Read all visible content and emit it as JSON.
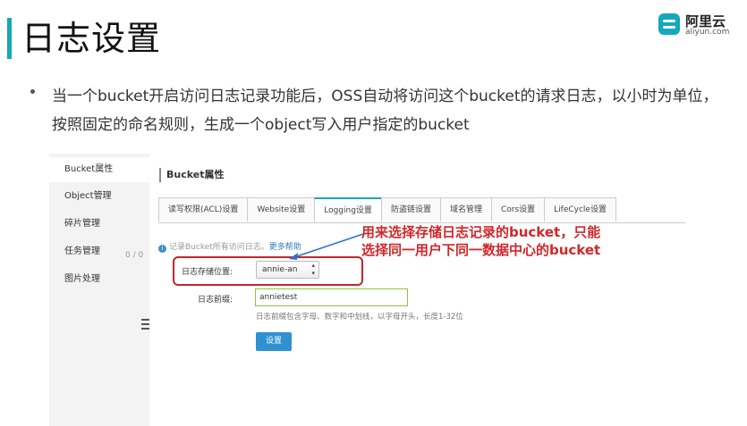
{
  "slide": {
    "title": "日志设置",
    "bullet": "当一个bucket开启访问日志记录功能后，OSS自动将访问这个bucket的请求日志，以小时为单位，按照固定的命名规则，生成一个object写入用户指定的bucket"
  },
  "logo": {
    "cn": "阿里云",
    "en": "aliyun.com"
  },
  "sidebar": {
    "items": [
      {
        "label": "Bucket属性"
      },
      {
        "label": "Object管理"
      },
      {
        "label": "碎片管理"
      },
      {
        "label": "任务管理"
      },
      {
        "label": "图片处理"
      }
    ],
    "task_count": "0 / 0"
  },
  "panel": {
    "title": "Bucket属性",
    "tabs": [
      {
        "label": "读写权限(ACL)设置"
      },
      {
        "label": "Website设置"
      },
      {
        "label": "Logging设置"
      },
      {
        "label": "防盗链设置"
      },
      {
        "label": "域名管理"
      },
      {
        "label": "Cors设置"
      },
      {
        "label": "LifeCycle设置"
      }
    ],
    "active_tab": "Logging设置",
    "info_text": "记录Bucket所有访问日志。",
    "help_link": "更多帮助"
  },
  "form": {
    "storage_label": "日志存储位置:",
    "storage_value": "annie-an",
    "prefix_label": "日志前缀:",
    "prefix_value": "annietest",
    "prefix_hint": "日志前缀包含字母、数字和中划线，以字母开头，长度1-32位",
    "save_label": "设置"
  },
  "annotation": {
    "line1": "用来选择存储日志记录的bucket，只能",
    "line2": "选择同一用户下同一数据中心的bucket"
  },
  "colors": {
    "accent": "#17a7b6",
    "annotation": "#d0272b",
    "button": "#2f91d2",
    "link": "#2a7ac4"
  }
}
